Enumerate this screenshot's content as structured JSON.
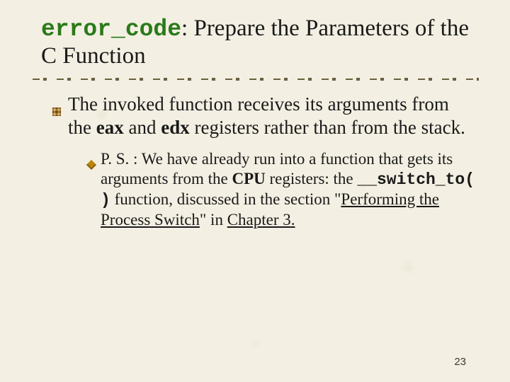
{
  "title": {
    "code": "error_code",
    "sep": ": ",
    "rest": "Prepare the Parameters of the C Function"
  },
  "bullet1": {
    "pre": "The invoked function receives its arguments from the ",
    "reg1": "eax",
    "mid1": " and ",
    "reg2": "edx",
    "post": " registers rather than from the stack."
  },
  "bullet2": {
    "ps_label": "P. S. ",
    "line1": ": We have already run into a function that gets its arguments from the ",
    "cpu": "CPU",
    "line1b": " registers: the ",
    "func": "__switch_to( )",
    "line2a": " function, discussed in the section \"",
    "link1": "Performing the Process Switch",
    "line2b": "\" in ",
    "link2": "Chapter 3",
    "dot": "."
  },
  "page_number": "23"
}
